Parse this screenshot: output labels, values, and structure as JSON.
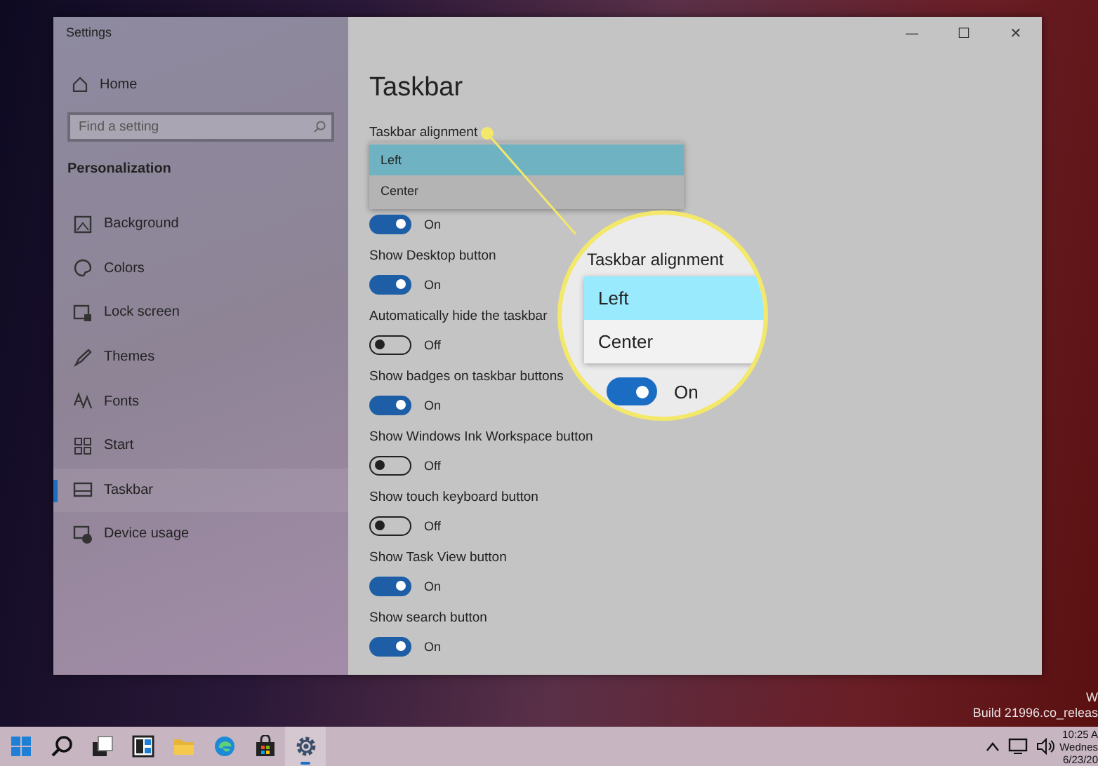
{
  "window": {
    "title": "Settings",
    "controls": [
      "—",
      "☐",
      "✕"
    ]
  },
  "sidebar": {
    "home": "Home",
    "search": {
      "placeholder": "Find a setting"
    },
    "section": "Personalization",
    "items": [
      {
        "label": "Background",
        "selected": false
      },
      {
        "label": "Colors",
        "selected": false
      },
      {
        "label": "Lock screen",
        "selected": false
      },
      {
        "label": "Themes",
        "selected": false
      },
      {
        "label": "Fonts",
        "selected": false
      },
      {
        "label": "Start",
        "selected": false
      },
      {
        "label": "Taskbar",
        "selected": true
      },
      {
        "label": "Device usage",
        "selected": false
      }
    ]
  },
  "content": {
    "title": "Taskbar",
    "alignment": {
      "label": "Taskbar alignment",
      "expanded": true,
      "options": [
        {
          "label": "Left",
          "selected": true
        },
        {
          "label": "Center",
          "selected": false
        }
      ]
    },
    "settings": [
      {
        "state": "On",
        "on": true
      },
      {
        "label": "Show Desktop button",
        "state": "On",
        "on": true
      },
      {
        "label": "Automatically hide the taskbar",
        "state": "Off",
        "on": false
      },
      {
        "label": "Show badges on taskbar buttons",
        "state": "On",
        "on": true
      },
      {
        "label": "Show Windows Ink Workspace button",
        "state": "Off",
        "on": false
      },
      {
        "label": "Show touch keyboard button",
        "state": "Off",
        "on": false
      },
      {
        "label": "Show Task View button",
        "state": "On",
        "on": true
      },
      {
        "label": "Show search button",
        "state": "On",
        "on": true
      }
    ]
  },
  "magnifier": {
    "label": "Taskbar alignment",
    "options": [
      {
        "label": "Left",
        "selected": true
      },
      {
        "label": "Center",
        "selected": false
      }
    ],
    "toggle": {
      "state": "On",
      "on": true
    }
  },
  "desktop": {
    "watermark": [
      "W",
      "Build 21996.co_releas"
    ]
  },
  "taskbar": {
    "apps": [
      {
        "kind": "start",
        "selected": false
      },
      {
        "kind": "search",
        "selected": false
      },
      {
        "kind": "taskview",
        "selected": false
      },
      {
        "kind": "widgets",
        "selected": false
      },
      {
        "kind": "folder",
        "selected": false
      },
      {
        "kind": "browser",
        "selected": false
      },
      {
        "kind": "store",
        "selected": false
      },
      {
        "kind": "settings",
        "selected": true
      }
    ],
    "clock": [
      "10:25 A",
      "Wednes",
      "6/23/20"
    ]
  }
}
